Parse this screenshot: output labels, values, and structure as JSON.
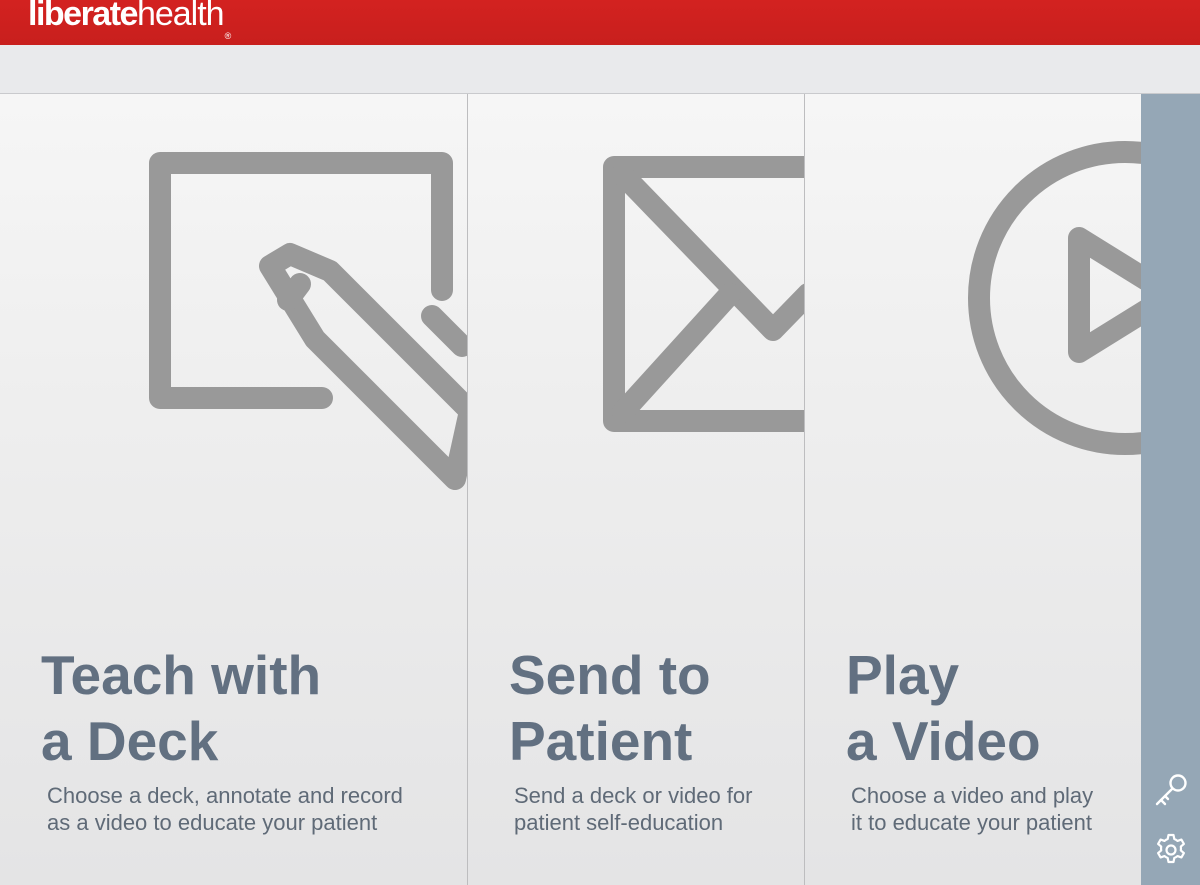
{
  "header": {
    "logo_bold": "liberate",
    "logo_light": "health",
    "logo_mark": "®",
    "brand_color": "#d32220"
  },
  "panels": [
    {
      "title_line1": "Teach with",
      "title_line2": "a Deck",
      "desc_line1": "Choose a deck, annotate and record",
      "desc_line2": "as a video to educate your patient",
      "icon": "pencil-square-icon"
    },
    {
      "title_line1": "Send to",
      "title_line2": "Patient",
      "desc_line1": "Send a deck or video for",
      "desc_line2": "patient self-education",
      "icon": "envelope-icon"
    },
    {
      "title_line1": "Play",
      "title_line2": "a Video",
      "desc_line1": "Choose a video and play",
      "desc_line2": "it to educate your patient",
      "icon": "play-circle-icon"
    }
  ],
  "sidebar": {
    "icons": [
      "key-icon",
      "gear-icon"
    ],
    "color": "#95a7b6"
  }
}
